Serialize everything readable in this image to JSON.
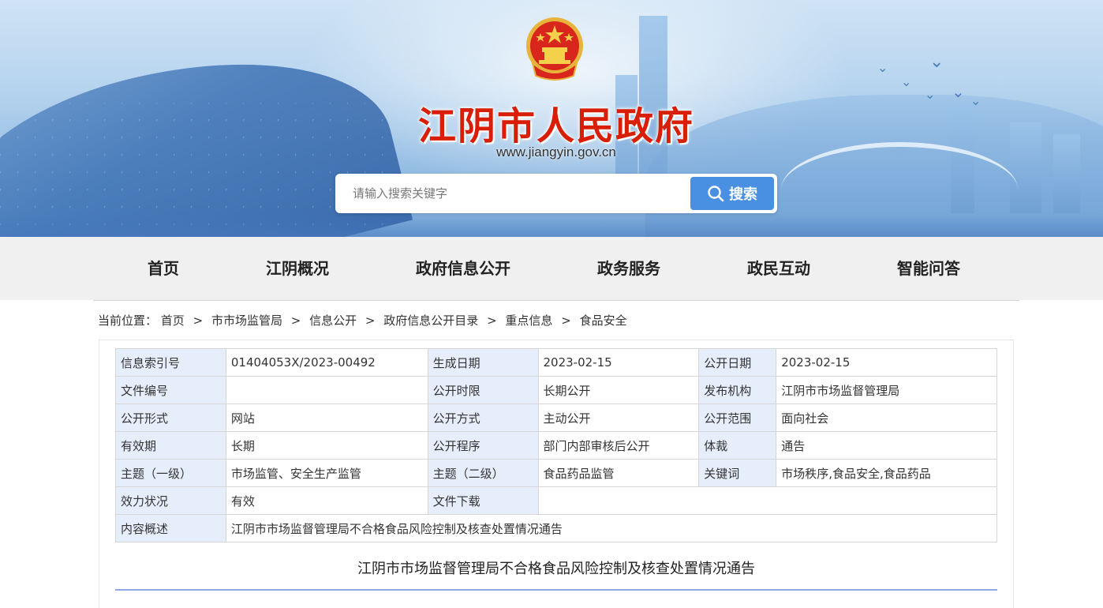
{
  "header": {
    "site_title": "江阴市人民政府",
    "site_url": "www.jiangyin.gov.cn",
    "emblem_icon": "national-emblem-icon",
    "search": {
      "placeholder": "请输入搜索关键字",
      "value": "",
      "button_label": "搜索",
      "button_icon": "search-icon",
      "button_color": "#4a90e2"
    },
    "title_color": "#d81e06"
  },
  "nav": {
    "items": [
      {
        "label": "首页"
      },
      {
        "label": "江阴概况"
      },
      {
        "label": "政府信息公开"
      },
      {
        "label": "政务服务"
      },
      {
        "label": "政民互动"
      },
      {
        "label": "智能问答"
      }
    ]
  },
  "breadcrumb": {
    "prefix": "当前位置：",
    "items": [
      "首页",
      "市市场监管局",
      "信息公开",
      "政府信息公开目录",
      "重点信息",
      "食品安全"
    ],
    "separator": ">"
  },
  "info_table": {
    "rows": [
      [
        {
          "label": "信息索引号",
          "value": "01404053X/2023-00492"
        },
        {
          "label": "生成日期",
          "value": "2023-02-15"
        },
        {
          "label": "公开日期",
          "value": "2023-02-15"
        }
      ],
      [
        {
          "label": "文件编号",
          "value": ""
        },
        {
          "label": "公开时限",
          "value": "长期公开"
        },
        {
          "label": "发布机构",
          "value": "江阴市市场监督管理局"
        }
      ],
      [
        {
          "label": "公开形式",
          "value": "网站"
        },
        {
          "label": "公开方式",
          "value": "主动公开"
        },
        {
          "label": "公开范围",
          "value": "面向社会"
        }
      ],
      [
        {
          "label": "有效期",
          "value": "长期"
        },
        {
          "label": "公开程序",
          "value": "部门内部审核后公开"
        },
        {
          "label": "体裁",
          "value": "通告"
        }
      ],
      [
        {
          "label": "主题（一级）",
          "value": "市场监管、安全生产监管"
        },
        {
          "label": "主题（二级）",
          "value": "食品药品监管"
        },
        {
          "label": "关键词",
          "value": "市场秩序,食品安全,食品药品"
        }
      ]
    ],
    "validity": {
      "label": "效力状况",
      "value": "有效"
    },
    "download": {
      "label": "文件下载",
      "value": ""
    },
    "summary": {
      "label": "内容概述",
      "value": "江阴市市场监督管理局不合格食品风险控制及核查处置情况通告"
    },
    "label_bg": "#e6edfb"
  },
  "document": {
    "title": "江阴市市场监督管理局不合格食品风险控制及核查处置情况通告",
    "rule_color": "#8ea9e8"
  }
}
